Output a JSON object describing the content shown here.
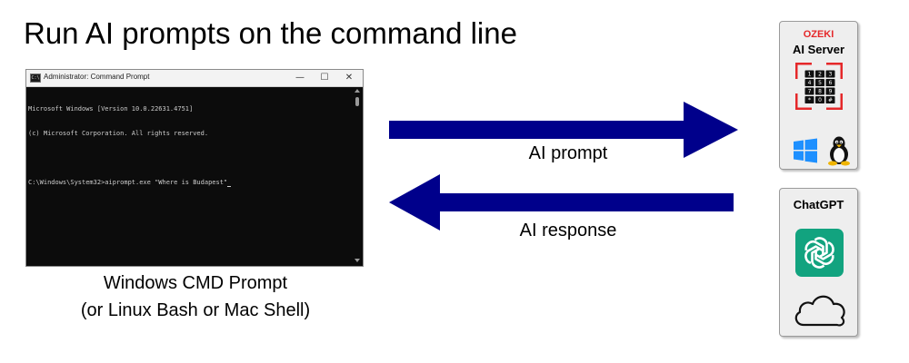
{
  "title": "Run AI prompts on the command line",
  "cmd_window": {
    "title": "Administrator: Command Prompt",
    "app_icon": "C:\\",
    "controls": {
      "minimize": "—",
      "maximize": "☐",
      "close": "✕"
    },
    "lines": [
      "Microsoft Windows [Version 10.0.22631.4751]",
      "(c) Microsoft Corporation. All rights reserved.",
      "",
      "C:\\Windows\\System32>aiprompt.exe \"Where is Budapest\""
    ]
  },
  "caption": {
    "line1": "Windows CMD Prompt",
    "line2": "(or Linux Bash or Mac Shell)"
  },
  "arrows": {
    "prompt_label": "AI prompt",
    "response_label": "AI response",
    "color": "#00008b"
  },
  "ozeki_panel": {
    "brand": "OZEKI",
    "name": "AI Server",
    "keypad": [
      "1",
      "2",
      "3",
      "4",
      "5",
      "6",
      "7",
      "8",
      "9",
      "*",
      "0",
      "#"
    ],
    "brand_color": "#e5282a",
    "os_icons": [
      "windows-icon",
      "linux-tux-icon"
    ]
  },
  "chatgpt_panel": {
    "name": "ChatGPT",
    "logo_color": "#12a37f",
    "icons": [
      "openai-logo-icon",
      "cloud-icon"
    ]
  }
}
